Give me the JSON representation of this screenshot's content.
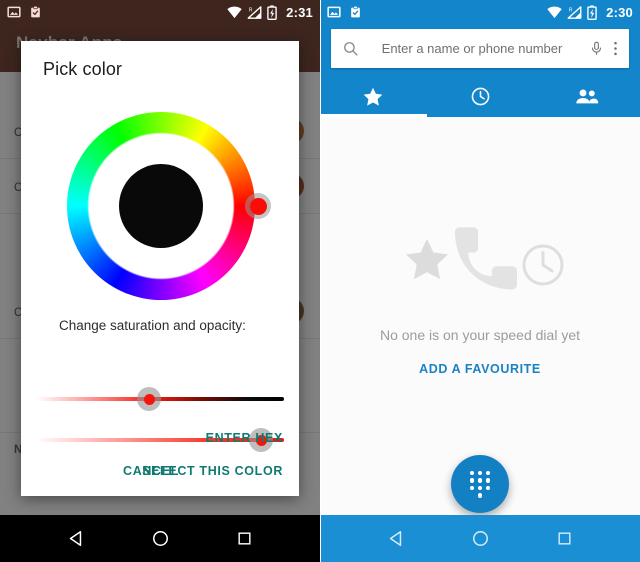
{
  "left": {
    "status_bar": {
      "time": "2:31",
      "icons_left": [
        "image-icon",
        "clipboard-check-icon"
      ],
      "icons_right": [
        "wifi-icon",
        "signal-roaming-icon",
        "battery-charging-icon"
      ],
      "background_color": "#5c2516"
    },
    "app": {
      "title": "Navbar Apps",
      "accent_color": "#5c2516",
      "rows": [
        {
          "label": "Color",
          "sub": "",
          "swatch": "#a8581f"
        },
        {
          "label": "Color",
          "sub": "",
          "swatch": "#8d3a14"
        },
        {
          "label": "Color",
          "sub": "",
          "swatch": "#6e4a1c"
        },
        {
          "label": "Navigation Bar widgets",
          "sub": "",
          "swatch": ""
        }
      ],
      "section_title": "Navigation Bar widgets"
    },
    "dialog": {
      "title": "Pick color",
      "slider_label": "Change saturation and opacity:",
      "wheel": {
        "selected_hue_color": "#fb0c08",
        "inner_preview_color": "#090909",
        "handle_angle_deg": 0
      },
      "sliders": [
        {
          "name": "saturation",
          "value_percent": 45
        },
        {
          "name": "opacity",
          "value_percent": 92
        }
      ],
      "buttons": {
        "enter_hex": "ENTER HEX",
        "cancel": "CANCEL",
        "select": "SELECT THIS COLOR",
        "color": "#0f7a70"
      }
    },
    "nav_bar": {
      "background_color": "#000000",
      "items": [
        "back-icon",
        "home-icon",
        "recents-icon"
      ]
    }
  },
  "right": {
    "status_bar": {
      "time": "2:30",
      "icons_left": [
        "image-icon",
        "clipboard-check-icon"
      ],
      "icons_right": [
        "wifi-icon",
        "signal-roaming-icon",
        "battery-charging-icon"
      ],
      "background_color": "#1386cb"
    },
    "search": {
      "placeholder": "Enter a name or phone number",
      "leading_icon": "search-icon",
      "trailing_icons": [
        "microphone-icon",
        "overflow-menu-icon"
      ]
    },
    "tabs": [
      {
        "name": "favourites",
        "icon": "star-icon",
        "selected": true
      },
      {
        "name": "recents",
        "icon": "clock-icon",
        "selected": false
      },
      {
        "name": "contacts",
        "icon": "people-icon",
        "selected": false
      }
    ],
    "empty_state": {
      "message": "No one is on your speed dial yet",
      "action": "ADD A FAVOURITE",
      "action_color": "#1a82c4",
      "art_icons": [
        "star-icon",
        "phone-handset-icon",
        "clock-icon"
      ]
    },
    "fab": {
      "name": "dialpad-fab",
      "icon": "dialpad-icon",
      "color": "#1480c4"
    },
    "nav_bar": {
      "background_color": "#1b8fd4",
      "items": [
        "back-icon",
        "home-icon",
        "recents-icon"
      ]
    }
  }
}
